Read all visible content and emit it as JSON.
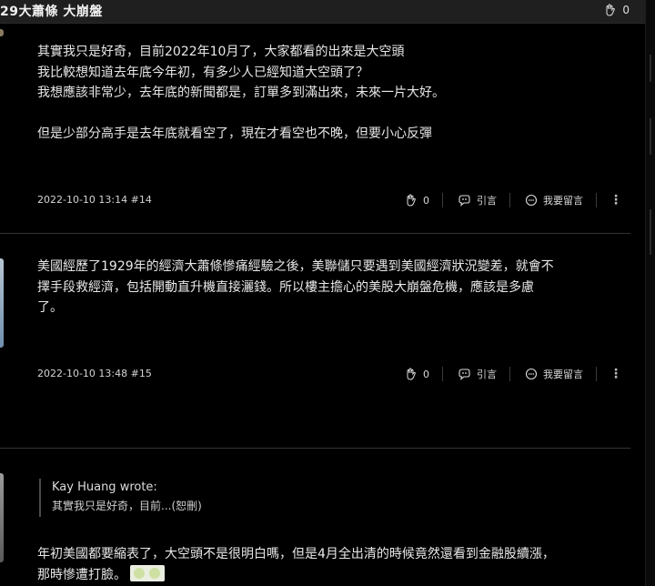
{
  "header": {
    "title": "29大蕭條 大崩盤",
    "like_count": "0"
  },
  "posts": [
    {
      "lines": [
        "其實我只是好奇，目前2022年10月了，大家都看的出來是大空頭",
        "我比較想知道去年底今年初，有多少人已經知道大空頭了？",
        "我想應該非常少，去年底的新聞都是，訂單多到滿出來，未來一片大好。",
        "",
        "但是少部分高手是去年底就看空了，現在才看空也不晚，但要小心反彈"
      ],
      "meta": "2022-10-10 13:14 #14",
      "like_count": "0",
      "quote_label": "引言",
      "reply_label": "我要留言"
    },
    {
      "lines": [
        "美國經歷了1929年的經濟大蕭條慘痛經驗之後，美聯儲只要遇到美國經濟狀況變差，就會不",
        "擇手段救經濟，包括開動直升機直接灑錢。所以樓主擔心的美股大崩盤危機，應該是多慮",
        "了。"
      ],
      "meta": "2022-10-10 13:48 #15",
      "like_count": "0",
      "quote_label": "引言",
      "reply_label": "我要留言"
    },
    {
      "quote_author": "Kay Huang wrote:",
      "quote_snippet": "其實我只是好奇，目前...(恕刪)",
      "lines": [
        "年初美國都要縮表了，大空頭不是很明白嗎，但是4月全出清的時候竟然還看到金融股續漲，",
        "那時慘遭打臉。"
      ]
    }
  ]
}
